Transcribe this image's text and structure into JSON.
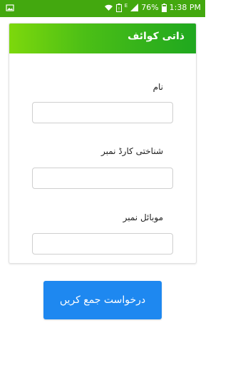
{
  "status_bar": {
    "battery_percent": "76%",
    "time": "1:38 PM",
    "network_type": "E",
    "icons": [
      "image-icon",
      "wifi-icon",
      "battery-saver-icon",
      "signal-icon",
      "battery-icon"
    ]
  },
  "form": {
    "title": "ذاتی کوائف",
    "fields": [
      {
        "label": "نام",
        "value": "",
        "placeholder": ""
      },
      {
        "label": "شناختی کارڈ نمبر",
        "value": "",
        "placeholder": ""
      },
      {
        "label": "موبائل نمبر",
        "value": "",
        "placeholder": ""
      }
    ]
  },
  "submit_label": "درخواست جمع کریں",
  "colors": {
    "status_bar": "#43a80f",
    "header_start": "#7dd80c",
    "header_end": "#1fa81f",
    "button": "#1e88f0"
  }
}
